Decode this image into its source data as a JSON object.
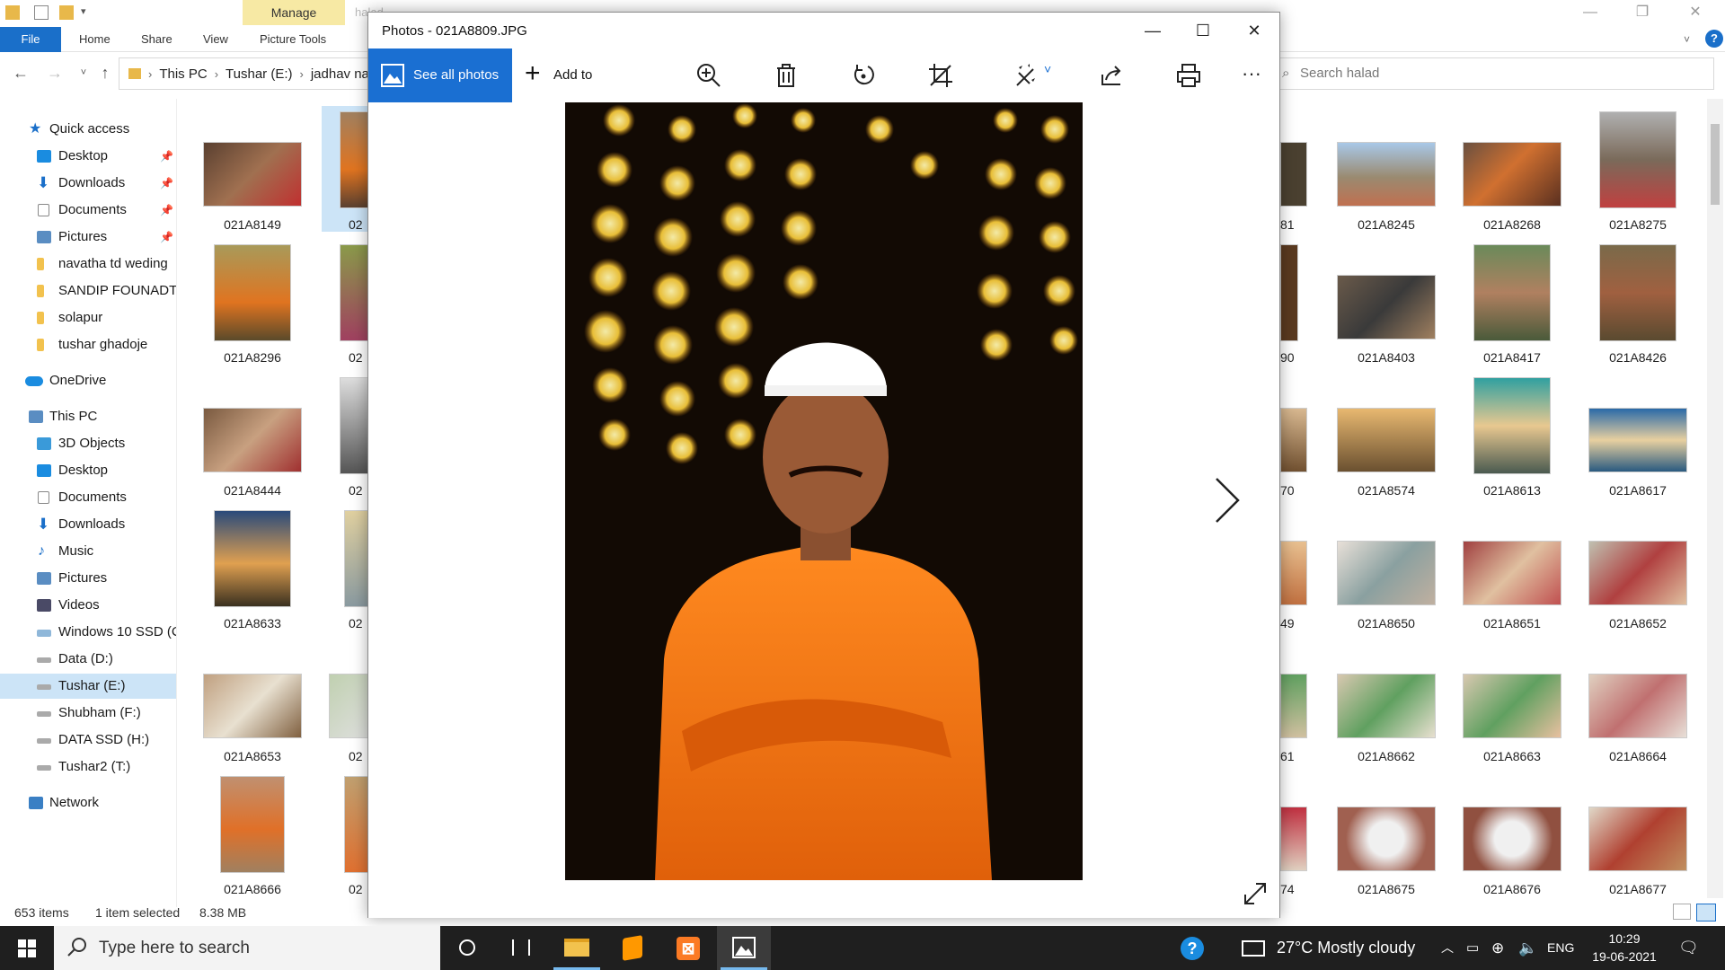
{
  "explorer": {
    "faded_title": "halad",
    "ribbon": {
      "file": "File",
      "home": "Home",
      "share": "Share",
      "view": "View",
      "manage": "Manage",
      "picture_tools": "Picture Tools"
    },
    "address": [
      "This PC",
      "Tushar (E:)",
      "jadhav na"
    ],
    "search_placeholder": "Search halad",
    "sidebar": {
      "quick_access": "Quick access",
      "quick_items": [
        "Desktop",
        "Downloads",
        "Documents",
        "Pictures",
        "navatha td weding",
        "SANDIP FOUNADTI",
        "solapur",
        "tushar ghadoje"
      ],
      "onedrive": "OneDrive",
      "this_pc": "This PC",
      "pc_items": [
        "3D Objects",
        "Desktop",
        "Documents",
        "Downloads",
        "Music",
        "Pictures",
        "Videos",
        "Windows 10 SSD (C",
        "Data (D:)",
        "Tushar (E:)",
        "Shubham (F:)",
        "DATA SSD (H:)",
        "Tushar2 (T:)"
      ],
      "network": "Network"
    },
    "left_files": [
      "021A8149",
      "021A8296",
      "021A8444",
      "021A8633",
      "021A8653",
      "021A8666"
    ],
    "left2_files": [
      "02",
      "02",
      "02",
      "02",
      "02",
      "02"
    ],
    "partial_files": [
      "81",
      "90",
      "70",
      "49",
      "61",
      "74"
    ],
    "right_files": [
      [
        "021A8245",
        "021A8268",
        "021A8275"
      ],
      [
        "021A8403",
        "021A8417",
        "021A8426"
      ],
      [
        "021A8574",
        "021A8613",
        "021A8617"
      ],
      [
        "021A8650",
        "021A8651",
        "021A8652"
      ],
      [
        "021A8662",
        "021A8663",
        "021A8664"
      ],
      [
        "021A8675",
        "021A8676",
        "021A8677"
      ]
    ],
    "status": {
      "items": "653 items",
      "selected": "1 item selected",
      "size": "8.38 MB"
    }
  },
  "photos": {
    "title": "Photos - 021A8809.JPG",
    "see_all": "See all photos",
    "add_to": "Add to"
  },
  "taskbar": {
    "search_placeholder": "Type here to search",
    "weather": "27°C  Mostly cloudy",
    "language": "ENG",
    "time": "10:29",
    "date": "19-06-2021"
  }
}
